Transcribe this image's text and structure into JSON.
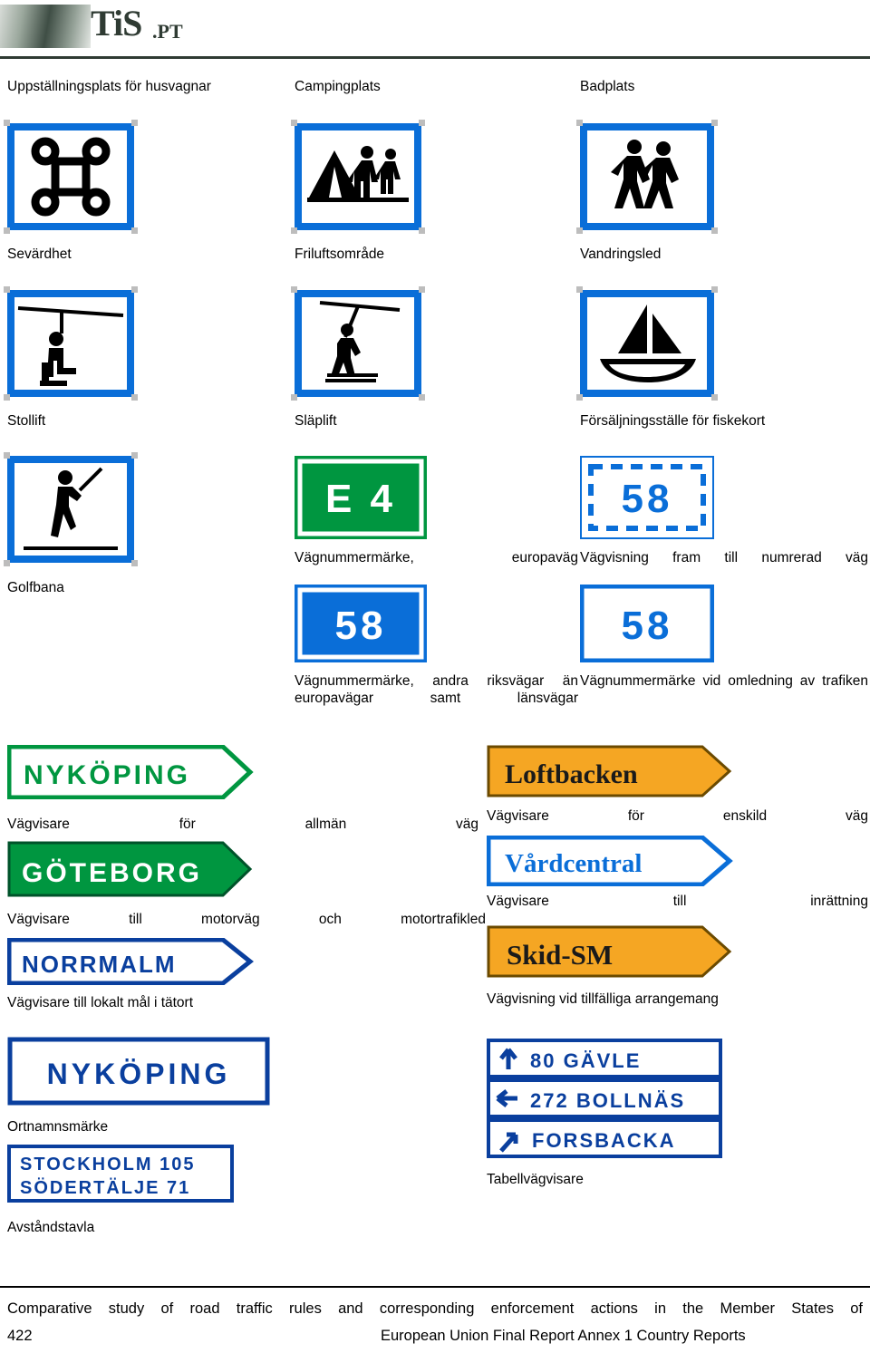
{
  "header": {
    "logo_text": "TiS",
    "logo_suffix": ".PT"
  },
  "captions": {
    "caravan": "Uppställningsplats för husvagnar",
    "camping": "Campingplats",
    "beach": "Badplats",
    "sight": "Sevärdhet",
    "outdoor": "Friluftsområde",
    "hiking": "Vandringsled",
    "chairlift": "Stollift",
    "draglift": "Släplift",
    "fishing": "Försäljningsställe för fiskekort",
    "golf": "Golfbana",
    "road_number_euro": "Vägnummermärke,           europaväg",
    "signpost_numbered": "Vägvisning   fram   till   numrerad   väg",
    "road_number_other": "Vägnummermärke,   andra   riksvägar än europavägar samt länsvägar",
    "detour": "Vägnummermärke  vid  omledning  av trafiken",
    "general_road": "Vägvisare               för             allmän               väg",
    "private_road": "Vägvisare            för           enskild           väg",
    "motorway": "Vägvisare     till     motorväg       och       motortrafikled",
    "institution": "Vägvisare                till              inrättning",
    "local_target": "Vägvisare till lokalt mål i tätort",
    "temporary": "Vägvisning vid tillfälliga arrangemang",
    "placename": "Ortnamnsmärke",
    "table_sign": "Tabellvägvisare",
    "distance_board": "Avståndstavla"
  },
  "signs": {
    "road_e4": "E 4",
    "road_58_blue": "58",
    "road_58_white": "58",
    "road_58_detour_a": "58",
    "road_58_detour_b": "58",
    "nykoping_green": "NYKÖPING",
    "goteborg_green": "GÖTEBORG",
    "norrmalm_blue": "NORRMALM",
    "loftbacken_orange": "Loftbacken",
    "vardcentral_white": "Vårdcentral",
    "skid_sm_orange": "Skid-SM",
    "nykoping_white": "NYKÖPING",
    "distance_rows": [
      {
        "name": "STOCKHOLM",
        "km": "105"
      },
      {
        "name": "SÖDERTÄLJE",
        "km": "71"
      }
    ],
    "table_rows": [
      {
        "arrow": "up",
        "num": "80",
        "name": "GÄVLE"
      },
      {
        "arrow": "left",
        "num": "272",
        "name": "BOLLNÄS"
      },
      {
        "arrow": "upright",
        "num": "",
        "name": "FORSBACKA"
      }
    ]
  },
  "footer": {
    "line1": "Comparative  study  of  road  traffic  rules  and  corresponding  enforcement  actions  in  the  Member  States  of",
    "page_number": "422",
    "line2": "European Union  Final Report  Annex 1  Country Reports"
  },
  "colors": {
    "sign_blue": "#0a6ed8",
    "sign_green": "#009640",
    "sign_orange": "#f5a623",
    "sign_white": "#ffffff",
    "accent_dark": "#2f3b33"
  }
}
